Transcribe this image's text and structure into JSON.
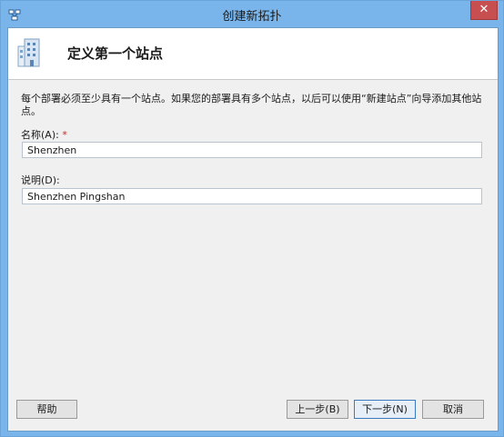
{
  "window": {
    "title": "创建新拓扑",
    "close_glyph": "✕"
  },
  "header": {
    "title": "定义第一个站点",
    "icon": "building-icon"
  },
  "body": {
    "description": "每个部署必须至少具有一个站点。如果您的部署具有多个站点，以后可以使用“新建站点”向导添加其他站点。"
  },
  "fields": {
    "name": {
      "label": "名称(A):",
      "required_mark": "*",
      "value": "Shenzhen"
    },
    "description": {
      "label": "说明(D):",
      "value": "Shenzhen Pingshan"
    }
  },
  "buttons": {
    "help": "帮助",
    "back": "上一步(B)",
    "next": "下一步(N)",
    "cancel": "取消"
  },
  "colors": {
    "titlebar": "#79b4ea",
    "close_button": "#c74f4f",
    "required": "#d21f1f"
  }
}
